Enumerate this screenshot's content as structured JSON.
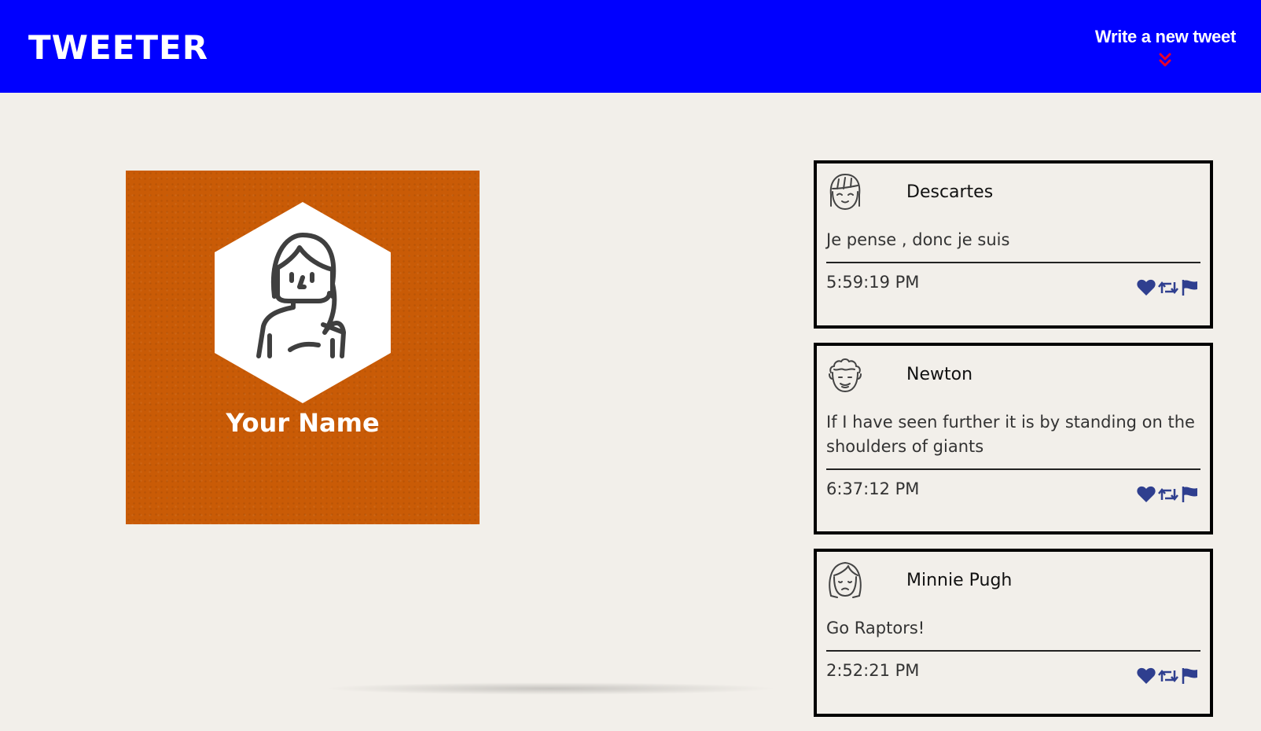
{
  "header": {
    "brand": "TWEETER",
    "compose_label": "Write a new tweet",
    "compose_icon": "double-chevron-down-icon",
    "colors": {
      "nav_bg": "#0000ff",
      "compose_icon": "#e8002a"
    }
  },
  "profile": {
    "name": "Your Name",
    "avatar_icon": "person-hexagon-icon",
    "colors": {
      "card_bg": "#c95b06"
    }
  },
  "tweets": [
    {
      "author": "Descartes",
      "avatar_icon": "face-bangs-icon",
      "text": "Je pense , donc je suis",
      "time": "5:59:19 PM"
    },
    {
      "author": "Newton",
      "avatar_icon": "face-curly-hair-icon",
      "text": "If I have seen further it is by standing on the shoulders of giants",
      "time": "6:37:12 PM"
    },
    {
      "author": "Minnie Pugh",
      "avatar_icon": "face-long-hair-icon",
      "text": "Go Raptors!",
      "time": "2:52:21 PM"
    }
  ],
  "tweet_actions": {
    "icons": [
      "heart-icon",
      "retweet-icon",
      "flag-icon"
    ],
    "color": "#2f3f8f"
  }
}
